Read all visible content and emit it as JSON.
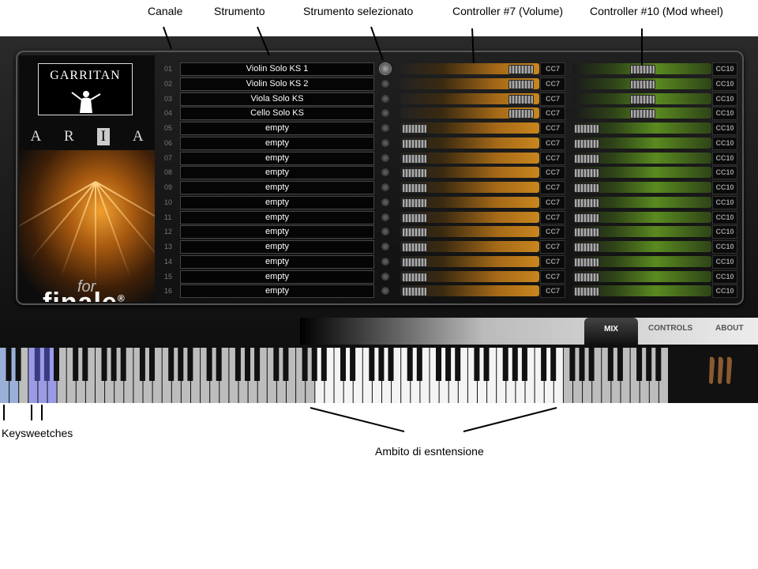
{
  "annotations": {
    "canale": "Canale",
    "strumento": "Strumento",
    "selezionato": "Strumento selezionato",
    "volume": "Controller #7 (Volume)",
    "modwheel": "Controller #10 (Mod wheel)",
    "keyswitches": "Keysweetches",
    "ambito": "Ambito di esntensione"
  },
  "brand": {
    "logo": "GARRITAN",
    "aria_letters": [
      "A",
      "R",
      "I",
      "A"
    ],
    "for": "for",
    "finale": "finale",
    "registered": "®"
  },
  "channels": [
    {
      "num": "01",
      "instrument": "Violin Solo KS 1",
      "selected": true,
      "vol": 0.95,
      "mod": 0.5
    },
    {
      "num": "02",
      "instrument": "Violin Solo KS 2",
      "selected": false,
      "vol": 0.95,
      "mod": 0.5
    },
    {
      "num": "03",
      "instrument": "Viola Solo KS",
      "selected": false,
      "vol": 0.95,
      "mod": 0.5
    },
    {
      "num": "04",
      "instrument": "Cello Solo KS",
      "selected": false,
      "vol": 0.95,
      "mod": 0.5
    },
    {
      "num": "05",
      "instrument": "empty",
      "selected": false,
      "vol": 0,
      "mod": 0
    },
    {
      "num": "06",
      "instrument": "empty",
      "selected": false,
      "vol": 0,
      "mod": 0
    },
    {
      "num": "07",
      "instrument": "empty",
      "selected": false,
      "vol": 0,
      "mod": 0
    },
    {
      "num": "08",
      "instrument": "empty",
      "selected": false,
      "vol": 0,
      "mod": 0
    },
    {
      "num": "09",
      "instrument": "empty",
      "selected": false,
      "vol": 0,
      "mod": 0
    },
    {
      "num": "10",
      "instrument": "empty",
      "selected": false,
      "vol": 0,
      "mod": 0
    },
    {
      "num": "11",
      "instrument": "empty",
      "selected": false,
      "vol": 0,
      "mod": 0
    },
    {
      "num": "12",
      "instrument": "empty",
      "selected": false,
      "vol": 0,
      "mod": 0
    },
    {
      "num": "13",
      "instrument": "empty",
      "selected": false,
      "vol": 0,
      "mod": 0
    },
    {
      "num": "14",
      "instrument": "empty",
      "selected": false,
      "vol": 0,
      "mod": 0
    },
    {
      "num": "15",
      "instrument": "empty",
      "selected": false,
      "vol": 0,
      "mod": 0
    },
    {
      "num": "16",
      "instrument": "empty",
      "selected": false,
      "vol": 0,
      "mod": 0
    }
  ],
  "cc_labels": {
    "volume": "CC7",
    "mod": "CC10"
  },
  "tabs": {
    "mix": "MIX",
    "controls": "CONTROLS",
    "about": "ABOUT"
  },
  "colors": {
    "volume_accent": "#c8861e",
    "mod_accent": "#5a8a20",
    "keyswitch": "#8a8ae0"
  }
}
